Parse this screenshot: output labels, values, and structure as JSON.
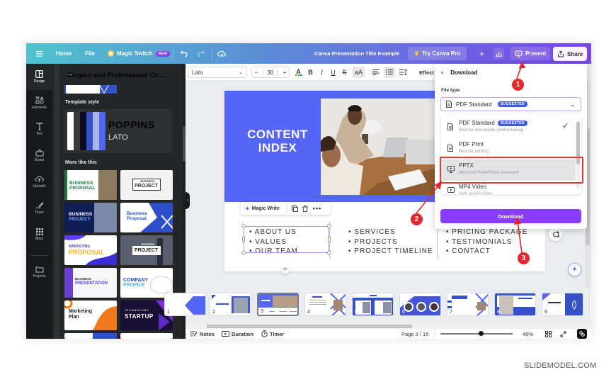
{
  "topbar": {
    "home": "Home",
    "file": "File",
    "magic_switch": "Magic Switch",
    "new_badge": "NEW",
    "doc_title": "Canva Presentation Title Example",
    "try_pro": "Try Canva Pro",
    "present": "Present",
    "share": "Share"
  },
  "rail": {
    "items": [
      {
        "label": "Design",
        "icon": "layout-icon",
        "active": true
      },
      {
        "label": "Elements",
        "icon": "shapes-icon"
      },
      {
        "label": "Text",
        "icon": "text-icon"
      },
      {
        "label": "Brand",
        "icon": "brand-icon"
      },
      {
        "label": "Uploads",
        "icon": "cloud-upload-icon"
      },
      {
        "label": "Draw",
        "icon": "pen-icon"
      },
      {
        "label": "Apps",
        "icon": "grid-icon"
      },
      {
        "label": "Projects",
        "icon": "folder-icon"
      }
    ]
  },
  "panel": {
    "title": "Elegant and Professional Co...",
    "template_style_label": "Template style",
    "style_font_heading": "POPPINS",
    "style_font_body": "LATO",
    "palette": [
      "#ffffff",
      "#3a3a3a",
      "#0d0b24",
      "#3451c6",
      "#a9b6e8",
      "#5566f7"
    ],
    "more_like_this_label": "More like this",
    "templates": [
      {
        "line1": "BUSINESS",
        "line2": "PROPOSAL"
      },
      {
        "line1": "BUSINESS",
        "line2": "PROJECT"
      },
      {
        "line1": "BUSINESS",
        "line2": "PROJECT"
      },
      {
        "line1": "Business",
        "line2": "Proposal."
      },
      {
        "line1": "MARKETING",
        "line2": "PROPOSAL"
      },
      {
        "line1": "BUSINESS",
        "line2": "PROJECT"
      },
      {
        "line1": "BUSINESS",
        "line2": "PRESENTATION"
      },
      {
        "line1": "COMPANY",
        "line2": "PROFILE"
      },
      {
        "line1": "Marketing",
        "line2": "Plan"
      },
      {
        "line1": "TECHNOLOGY",
        "line2": "STARTUP"
      }
    ]
  },
  "toolbar": {
    "font": "Lato",
    "font_size": "30",
    "minus": "–",
    "plus": "+",
    "bold": "B",
    "italic": "I",
    "underline": "U",
    "strike": "S",
    "case": "aA",
    "effects": "Effect"
  },
  "slide": {
    "title_line1": "CONTENT",
    "title_line2": "INDEX",
    "columns": [
      [
        "ABOUT US",
        "VALUES",
        "OUR TEAM"
      ],
      [
        "SERVICES",
        "PROJECTS",
        "PROJECT TIMELINE"
      ],
      [
        "PRICING PACKAGE",
        "TESTIMONIALS",
        "CONTACT"
      ]
    ],
    "hero_color": "#5566f7"
  },
  "context_menu": {
    "magic_write": "Magic Write"
  },
  "download": {
    "header": "Download",
    "file_type_label": "File type",
    "selected": "PDF Standard",
    "suggested_badge": "SUGGESTED",
    "options": [
      {
        "name": "PDF Standard",
        "desc": "Best for documents (and emailing)",
        "suggested": true,
        "checked": true
      },
      {
        "name": "PDF Print",
        "desc": "Best for printing"
      },
      {
        "name": "PPTX",
        "desc": "Microsoft PowerPoint document",
        "highlighted": true
      },
      {
        "name": "MP4 Video",
        "desc": "High quality video"
      }
    ],
    "button": "Download",
    "accent": "#8b3dff"
  },
  "filmstrip": {
    "pages": [
      "1",
      "2",
      "3",
      "4",
      "5",
      "6",
      "7",
      "8",
      "9"
    ],
    "selected_page": "3"
  },
  "footer": {
    "notes": "Notes",
    "duration": "Duration",
    "timer": "Timer",
    "page": "Page 3 / 15",
    "zoom": "46%",
    "zoom_fraction": 0.46
  },
  "annotations": {
    "step1": "1",
    "step2": "2",
    "step3": "3",
    "color": "#e3262e"
  },
  "watermark": "SLIDEMODEL.COM"
}
